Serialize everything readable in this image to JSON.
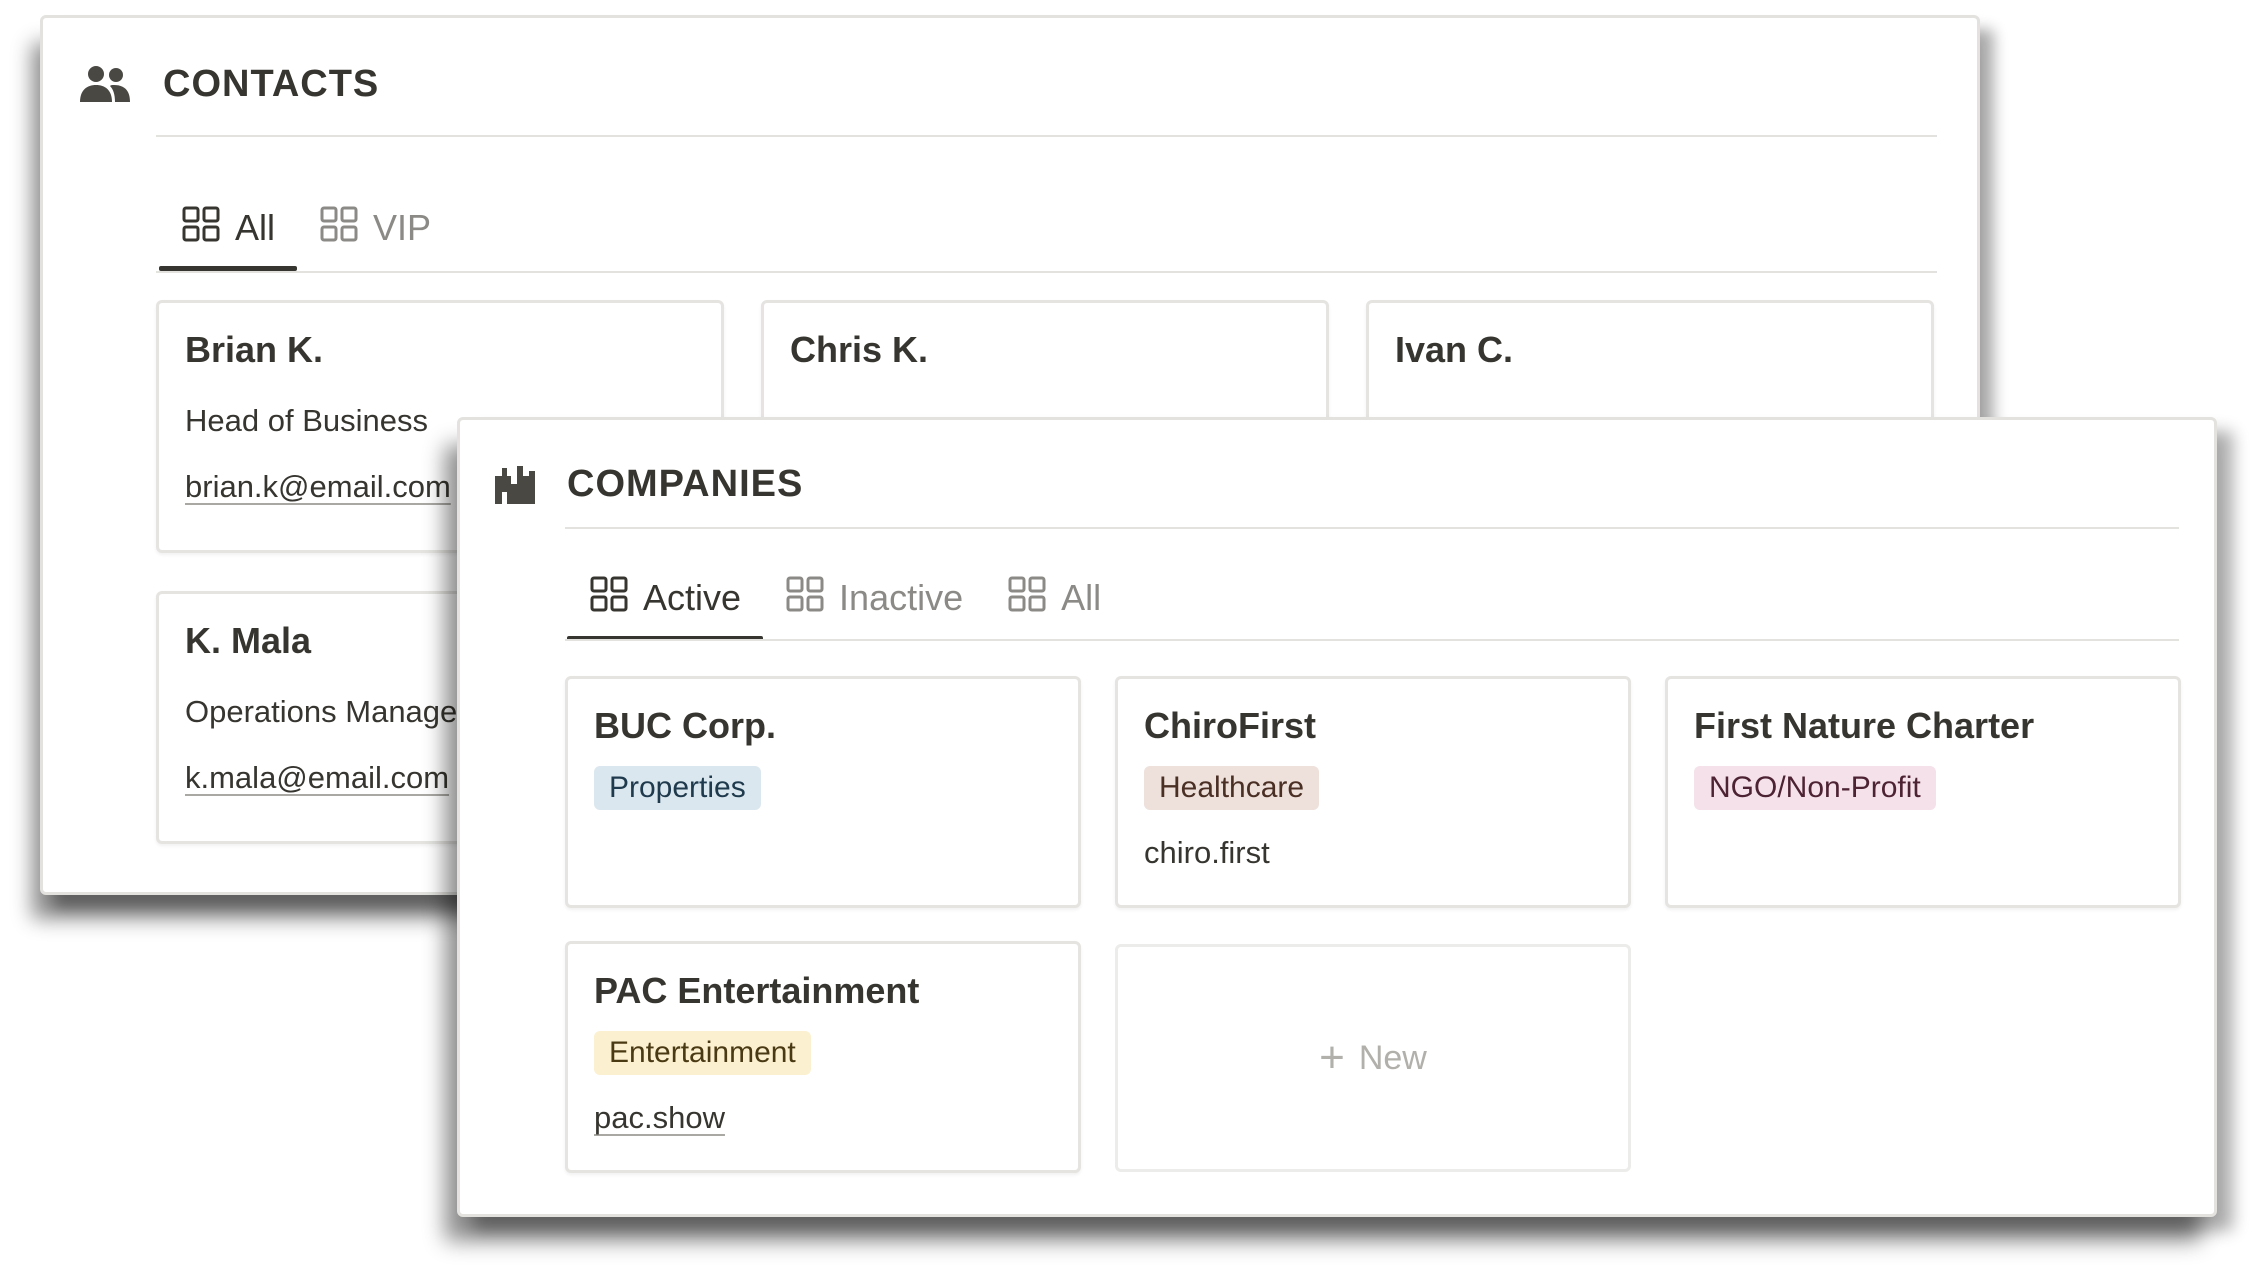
{
  "contacts": {
    "title": "CONTACTS",
    "icon": "people-icon",
    "tabs": [
      {
        "label": "All",
        "icon": "gallery-icon",
        "active": true
      },
      {
        "label": "VIP",
        "icon": "gallery-icon",
        "active": false
      }
    ],
    "cards": [
      {
        "name": "Brian K.",
        "role": "Head of Business",
        "email": "brian.k@email.com"
      },
      {
        "name": "Chris K.",
        "role": "",
        "email": ""
      },
      {
        "name": "Ivan C.",
        "role": "",
        "email": ""
      },
      {
        "name": "K. Mala",
        "role": "Operations Manager",
        "email": "k.mala@email.com"
      }
    ]
  },
  "companies": {
    "title": "COMPANIES",
    "icon": "building-icon",
    "tabs": [
      {
        "label": "Active",
        "icon": "gallery-icon",
        "active": true
      },
      {
        "label": "Inactive",
        "icon": "gallery-icon",
        "active": false
      },
      {
        "label": "All",
        "icon": "gallery-icon",
        "active": false
      }
    ],
    "cards": [
      {
        "name": "BUC Corp.",
        "tag": "Properties",
        "tag_bg": "#dbe7ee",
        "tag_color": "#1f3a4d",
        "site": ""
      },
      {
        "name": "ChiroFirst",
        "tag": "Healthcare",
        "tag_bg": "#eee0da",
        "tag_color": "#4a2f25",
        "site": "chiro.first"
      },
      {
        "name": "First Nature Charter",
        "tag": "NGO/Non-Profit",
        "tag_bg": "#f4e1e9",
        "tag_color": "#4d2333",
        "site": ""
      },
      {
        "name": "PAC Entertainment",
        "tag": "Entertainment",
        "tag_bg": "#fbf0cf",
        "tag_color": "#4a3a14",
        "site": "pac.show"
      }
    ],
    "new_label": "New"
  },
  "colors": {
    "text": "#37352f",
    "muted": "#8c8a86",
    "border": "#e3e2df"
  }
}
